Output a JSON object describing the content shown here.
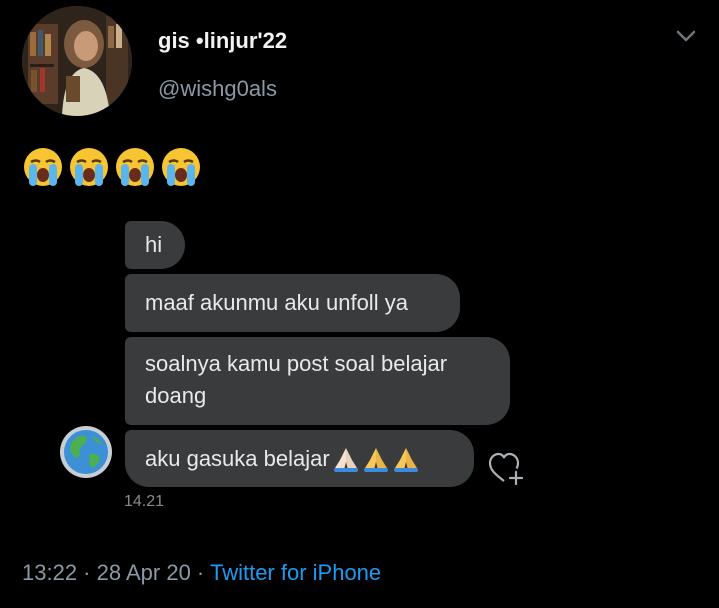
{
  "tweet": {
    "display_name": "gis •linjur'22",
    "handle": "@wishg0als",
    "emoji_text": "😭😭😭😭",
    "time": "13:22",
    "separator": " · ",
    "date": "28 Apr 20",
    "source": "Twitter for iPhone"
  },
  "dm": {
    "messages": [
      {
        "text": "hi"
      },
      {
        "text": "maaf akunmu aku unfoll ya"
      },
      {
        "text": "soalnya kamu post soal belajar doang"
      },
      {
        "text": "aku gasuka belajar",
        "emoji": "🙏🏻🙏🙏"
      }
    ],
    "timestamp": "14.21"
  },
  "icons": {
    "menu": "chevron-down-icon",
    "react": "heart-plus-icon",
    "emoji": "loudly-crying-face-icon",
    "pray": "folded-hands-icon",
    "sender_avatar": "globe-icon"
  },
  "colors": {
    "background": "#000000",
    "bubble": "#3a3b3d",
    "link": "#1d9bf0",
    "muted": "#8b98a5"
  }
}
